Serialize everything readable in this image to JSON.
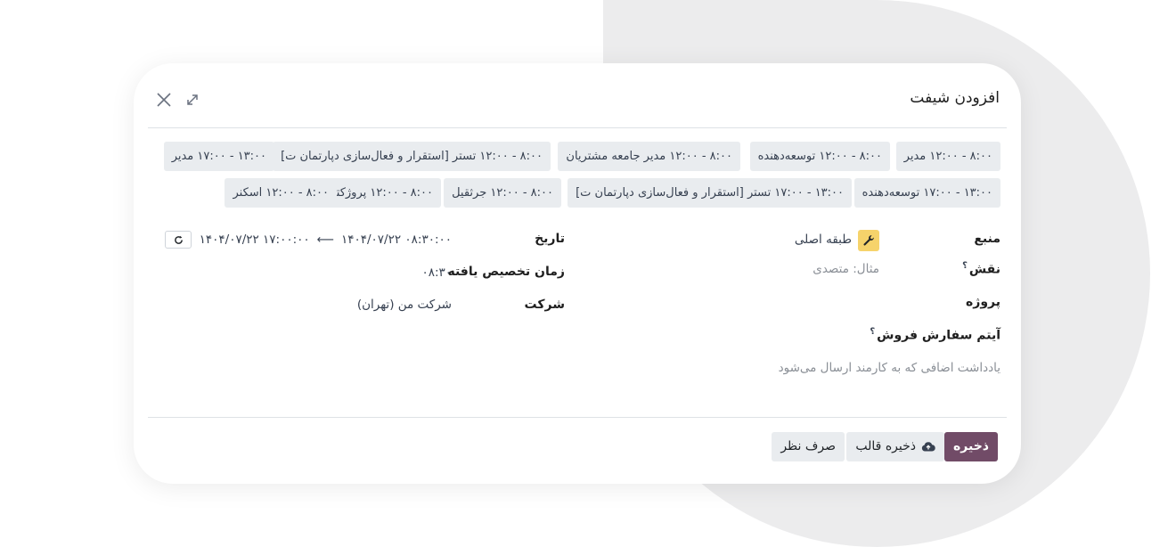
{
  "dialog": {
    "title": "افزودن شیفت"
  },
  "templates": {
    "row1": [
      "۸:۰۰ - ۱۲:۰۰ مدیر",
      "۸:۰۰ - ۱۲:۰۰ توسعه‌دهنده",
      "۸:۰۰ - ۱۲:۰۰ مدیر جامعه مشتریان",
      "۸:۰۰ - ۱۲:۰۰ تستر [استقرار و فعال‌سازی دپارتمان ت]",
      "۱۳:۰۰ - ۱۷:۰۰ مدیر"
    ],
    "row2": [
      "۱۳:۰۰ - ۱۷:۰۰ توسعه‌دهنده",
      "۱۳:۰۰ - ۱۷:۰۰ تستر [استقرار و فعال‌سازی دپارتمان ت]",
      "۸:۰۰ - ۱۲:۰۰ جرثقیل",
      "۸:۰۰ - ۱۲:۰۰ پروژکتور",
      "۸:۰۰ - ۱۲:۰۰ اسکنر"
    ]
  },
  "form": {
    "resource_label": "منبع",
    "resource_value": "طبقه اصلی",
    "role_label": "نقش",
    "role_help": "؟",
    "role_placeholder": "مثال: متصدی",
    "project_label": "پروژه",
    "sale_item_label": "آیتم سفارش فروش",
    "sale_item_help": "؟",
    "note_placeholder": "یادداشت اضافی که به کارمند ارسال می‌شود",
    "date_label": "تاریخ",
    "date_start": "۱۴۰۴/۰۷/۲۲ ۰۸:۳۰:۰۰",
    "date_arrow": "⟵",
    "date_end": "۱۴۰۴/۰۷/۲۲ ۱۷:۰۰:۰۰",
    "allocated_label": "زمان تخصیص یافته",
    "allocated_value": "۰۸:۳۰",
    "company_label": "شرکت",
    "company_value": "شرکت من (تهران)"
  },
  "footer": {
    "save_label": "ذخیره",
    "save_template_label": "ذخیره قالب",
    "discard_label": "صرف نظر"
  },
  "colors": {
    "primary": "#714b67",
    "avatar": "#f6d36b",
    "chip": "#e9ecef",
    "backdrop_shape": "#ececed"
  }
}
